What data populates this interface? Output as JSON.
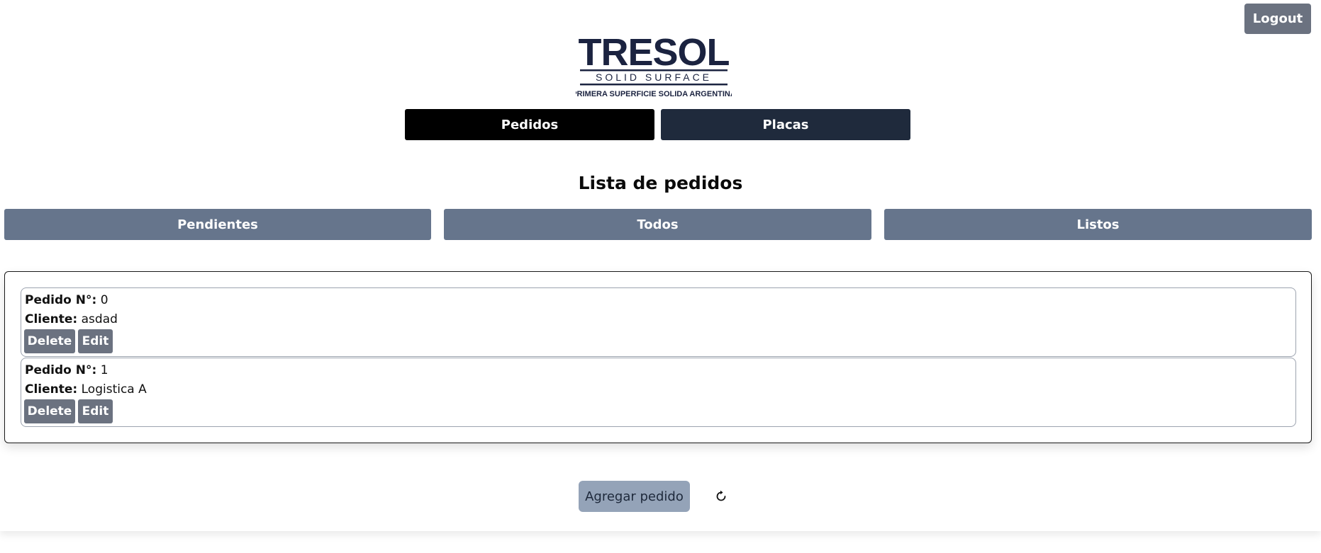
{
  "header": {
    "logout_label": "Logout",
    "logo": {
      "brand": "TRESOL",
      "sub": "SOLID SURFACE",
      "tagline": "PRIMERA SUPERFICIE SOLIDA ARGENTINA",
      "color": "#1b2340"
    }
  },
  "nav": {
    "pedidos_label": "Pedidos",
    "placas_label": "Placas"
  },
  "main": {
    "title": "Lista de pedidos",
    "filters": {
      "pendientes": "Pendientes",
      "todos": "Todos",
      "listos": "Listos"
    },
    "orders": [
      {
        "pedido_label": "Pedido N°:",
        "pedido_value": "0",
        "cliente_label": "Cliente:",
        "cliente_value": "asdad",
        "delete_label": "Delete",
        "edit_label": "Edit"
      },
      {
        "pedido_label": "Pedido N°:",
        "pedido_value": "1",
        "cliente_label": "Cliente:",
        "cliente_value": "Logistica A",
        "delete_label": "Delete",
        "edit_label": "Edit"
      }
    ],
    "add_label": "Agregar pedido",
    "refresh_icon": "refresh-icon"
  },
  "colors": {
    "nav_active": "#000000",
    "nav_inactive": "#1f2a3c",
    "filter_bg": "#66758c",
    "card_button": "#6b7280",
    "add_button": "#94a3b8"
  }
}
